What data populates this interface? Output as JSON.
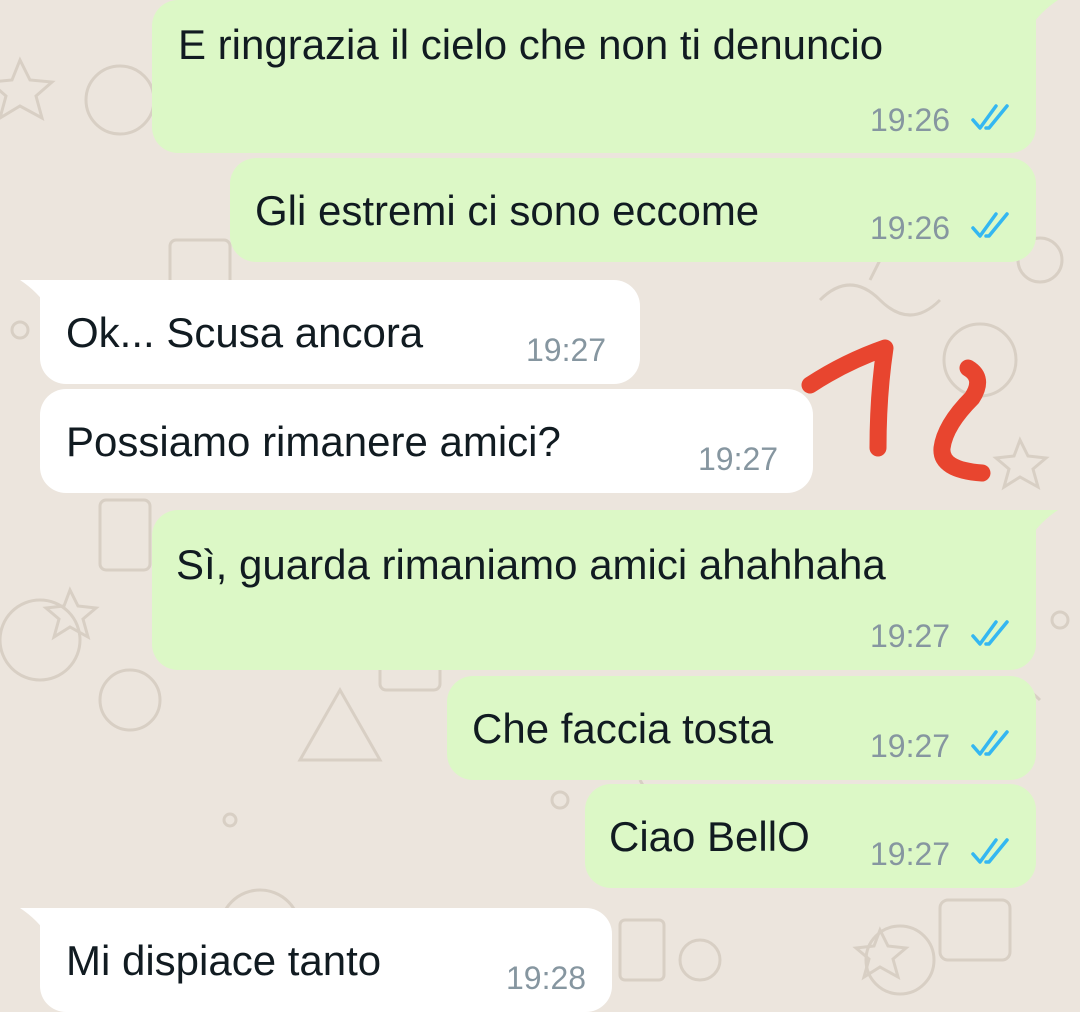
{
  "messages": [
    {
      "text": "E ringrazia il cielo che  non ti denuncio",
      "time": "19:26",
      "direction": "outgoing",
      "status": "read"
    },
    {
      "text": "Gli estremi ci sono eccome",
      "time": "19:26",
      "direction": "outgoing",
      "status": "read"
    },
    {
      "text": "Ok... Scusa ancora",
      "time": "19:27",
      "direction": "incoming"
    },
    {
      "text": "Possiamo rimanere amici?",
      "time": "19:27",
      "direction": "incoming"
    },
    {
      "text": "Sì, guarda rimaniamo amici ahahhaha",
      "time": "19:27",
      "direction": "outgoing",
      "status": "read"
    },
    {
      "text": "Che faccia tosta",
      "time": "19:27",
      "direction": "outgoing",
      "status": "read"
    },
    {
      "text": "Ciao BellO",
      "time": "19:27",
      "direction": "outgoing",
      "status": "read"
    },
    {
      "text": "Mi dispiace tanto",
      "time": "19:28",
      "direction": "incoming"
    }
  ],
  "colors": {
    "outgoing_bubble": "#dcf8c6",
    "incoming_bubble": "#ffffff",
    "read_ticks": "#34b7f1",
    "annotation": "#e8452f",
    "background": "#ece5dd"
  },
  "icons": {
    "read_receipt": "double-check-icon",
    "annotation": "hand-drawn-red-marks"
  }
}
